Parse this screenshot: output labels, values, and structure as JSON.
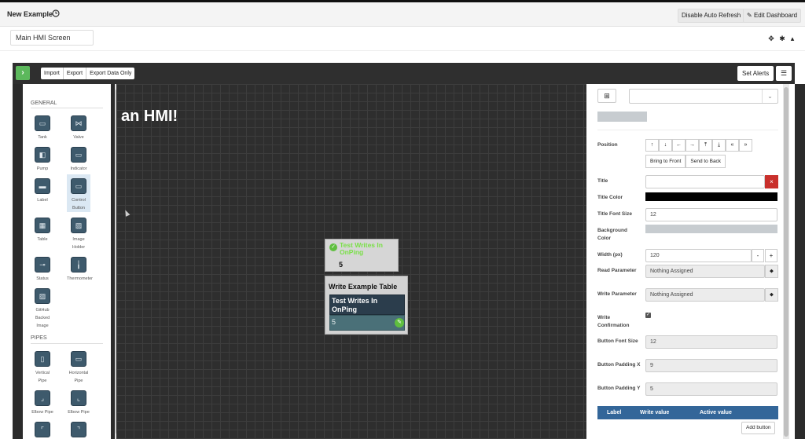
{
  "topbar": {
    "title": "New Example",
    "disable_refresh": "Disable Auto Refresh",
    "edit_dashboard": "Edit Dashboard"
  },
  "screen": {
    "name": "Main HMI Screen"
  },
  "toolbar": {
    "import": "Import",
    "export": "Export",
    "export_data_only": "Export Data Only",
    "set_alerts": "Set Alerts"
  },
  "palette": {
    "general_heading": "GENERAL",
    "pipes_heading": "PIPES",
    "items": [
      {
        "label": "Tank"
      },
      {
        "label": "Valve"
      },
      {
        "label": "Pump"
      },
      {
        "label": "Indicator"
      },
      {
        "label": "Label"
      },
      {
        "label": "Control Button"
      },
      {
        "label": "Table"
      },
      {
        "label": "Image Holder"
      },
      {
        "label": "Status"
      },
      {
        "label": "Thermometer"
      },
      {
        "label": "GitHub Backed Image"
      }
    ],
    "pipe_items": [
      {
        "label": "Vertical Pipe"
      },
      {
        "label": "Horizontal Pipe"
      },
      {
        "label": "Elbow Pipe"
      },
      {
        "label": "Elbow Pipe"
      }
    ]
  },
  "canvas": {
    "heading": "an HMI!",
    "widget1": {
      "title": "Test Writes In OnPing",
      "value": "5"
    },
    "widget2": {
      "header": "Write Example Table",
      "button_label": "Test Writes In OnPing",
      "value": "5"
    }
  },
  "properties": {
    "position_label": "Position",
    "bring_to_front": "Bring to Front",
    "send_to_back": "Send to Back",
    "title_label": "Title",
    "title_value": "",
    "title_color_label": "Title Color",
    "title_color": "#000000",
    "title_font_size_label": "Title Font Size",
    "title_font_size": "12",
    "background_color_label": "Background Color",
    "background_color": "#c7ccd0",
    "width_label": "Width (px)",
    "width_value": "120",
    "read_param_label": "Read Parameter",
    "read_param_value": "Nothing Assigned",
    "write_param_label": "Write Parameter",
    "write_param_value": "Nothing Assigned",
    "write_confirmation_label": "Write Confirmation",
    "button_font_size_label": "Button Font Size",
    "button_font_size": "12",
    "button_padding_x_label": "Button Padding X",
    "button_padding_x": "9",
    "button_padding_y_label": "Button Padding Y",
    "button_padding_y": "5",
    "table_cols": [
      "Label",
      "Write value",
      "Active value"
    ],
    "add_button": "Add button"
  }
}
